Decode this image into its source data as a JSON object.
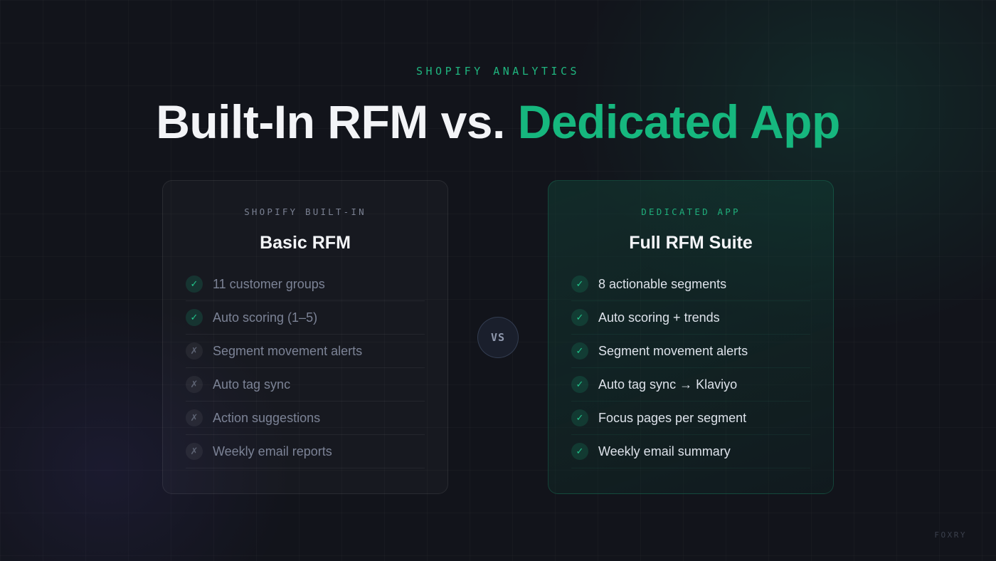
{
  "header": {
    "eyebrow": "SHOPIFY ANALYTICS",
    "title_part1": "Built-In RFM vs.",
    "title_part2": "Dedicated App"
  },
  "left_card": {
    "label": "SHOPIFY BUILT-IN",
    "title": "Basic RFM",
    "items": [
      {
        "text": "11 customer groups",
        "included": true,
        "mark": "✓"
      },
      {
        "text": "Auto scoring (1–5)",
        "included": true,
        "mark": "✓"
      },
      {
        "text": "Segment movement alerts",
        "included": false,
        "mark": "✗"
      },
      {
        "text": "Auto tag sync",
        "included": false,
        "mark": "✗"
      },
      {
        "text": "Action suggestions",
        "included": false,
        "mark": "✗"
      },
      {
        "text": "Weekly email reports",
        "included": false,
        "mark": "✗"
      }
    ]
  },
  "vs_label": "VS",
  "right_card": {
    "label": "DEDICATED APP",
    "title": "Full RFM Suite",
    "items": [
      {
        "text": "8 actionable segments",
        "included": true,
        "mark": "✓"
      },
      {
        "text": "Auto scoring + trends",
        "included": true,
        "mark": "✓"
      },
      {
        "text": "Segment movement alerts",
        "included": true,
        "mark": "✓"
      },
      {
        "text": "Auto tag sync → Klaviyo",
        "included": true,
        "mark": "✓"
      },
      {
        "text": "Focus pages per segment",
        "included": true,
        "mark": "✓"
      },
      {
        "text": "Weekly email summary",
        "included": true,
        "mark": "✓"
      }
    ]
  },
  "brand": "FOXRY",
  "colors": {
    "accent": "#16b77e",
    "background": "#12141b",
    "muted_text": "#7c8396"
  }
}
